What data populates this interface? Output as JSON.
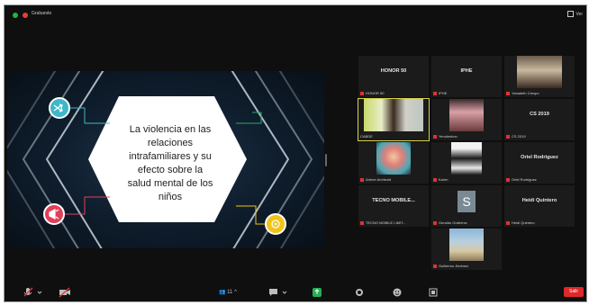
{
  "topbar": {
    "speaker_label": "Grabando",
    "view_label": "Ver"
  },
  "slide": {
    "title_lines": [
      "La violencia en las",
      "relaciones",
      "intrafamiliares y su",
      "efecto sobre la",
      "salud mental de los",
      "niños"
    ],
    "colors": {
      "background": "#0e1c2b",
      "hexagon": "#ffffff",
      "teal": "#3fb6c9",
      "red": "#e0405a",
      "yellow": "#f2c318",
      "green": "#2ea56a"
    }
  },
  "gallery": {
    "tiles": [
      {
        "name": "HONOR 50",
        "label": "HONOR 50"
      },
      {
        "name": "IPHE",
        "label": "IPHE"
      },
      {
        "name": "",
        "label": "Yamaleth Crespo"
      },
      {
        "name": "",
        "label": "CABDE"
      },
      {
        "name": "",
        "label": "Yenoleshon"
      },
      {
        "name": "CS 2019",
        "label": "CS 2019"
      },
      {
        "name": "",
        "label": "Arlene Archbold"
      },
      {
        "name": "",
        "label": "Karim"
      },
      {
        "name": "Oriel Rodriguez",
        "label": "Oriel Rodriguez"
      },
      {
        "name": "TECNO MOBILE...",
        "label": "TECNO MOBILE LIMIT..."
      },
      {
        "name": "S",
        "label": "Geraldo Gutierrez"
      },
      {
        "name": "Heidi Quintero",
        "label": "Heidi Quintero"
      },
      {
        "name": "",
        "label": "Guillermo Jiménez"
      }
    ]
  },
  "toolbar": {
    "participants_count": "11",
    "leave_label": "Salir"
  }
}
